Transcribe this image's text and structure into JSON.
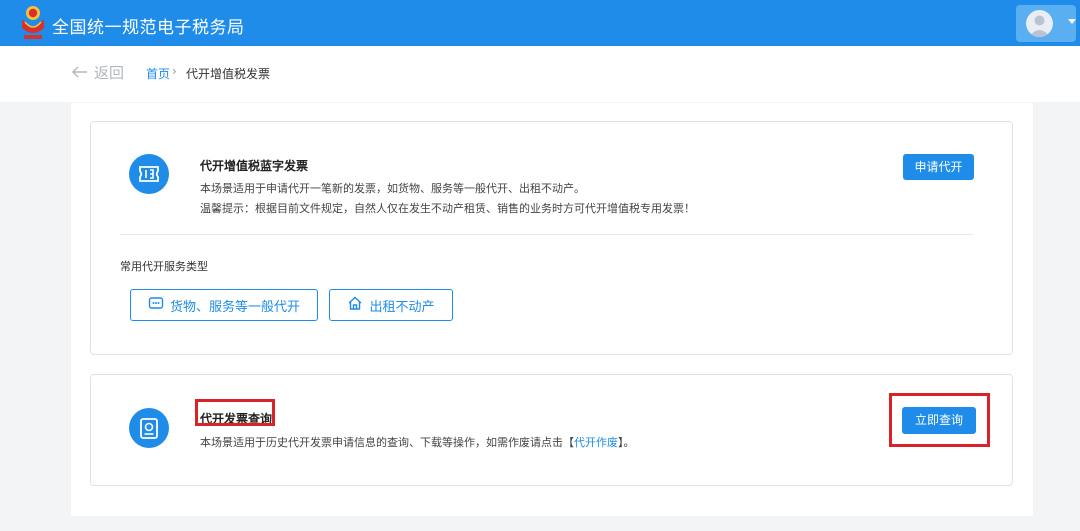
{
  "header": {
    "site_title": "全国统一规范电子税务局",
    "emblem_icon": "tax-emblem-icon",
    "user_icon": "user-avatar-icon",
    "dropdown_icon": "caret-down-icon"
  },
  "breadcrumb": {
    "back_label": "返回",
    "home_label": "首页",
    "separator": "›",
    "current_label": "代开增值税发票"
  },
  "issue_card": {
    "icon": "ticket-icon",
    "title": "代开增值税蓝字发票",
    "description": "本场景适用于申请代开一笔新的发票，如货物、服务等一般代开、出租不动产。",
    "tip": "温馨提示：根据目前文件规定，自然人仅在发生不动产租赁、销售的业务时方可代开增值税专用发票！",
    "apply_button": "申请代开",
    "common_types_label": "常用代开服务类型",
    "service_types": [
      {
        "label": "货物、服务等一般代开",
        "icon": "goods-service-icon"
      },
      {
        "label": "出租不动产",
        "icon": "house-icon"
      }
    ]
  },
  "query_card": {
    "icon": "invoice-search-icon",
    "title": "代开发票查询",
    "description_prefix": "本场景适用于历史代开发票申请信息的查询、下载等操作，如需作废请点击【",
    "description_link": "代开作废",
    "description_suffix": "】。",
    "query_button": "立即查询"
  },
  "colors": {
    "brand_blue": "#1e8ce8",
    "highlight_red": "#d9222a",
    "page_bg": "#f3f4f6"
  }
}
